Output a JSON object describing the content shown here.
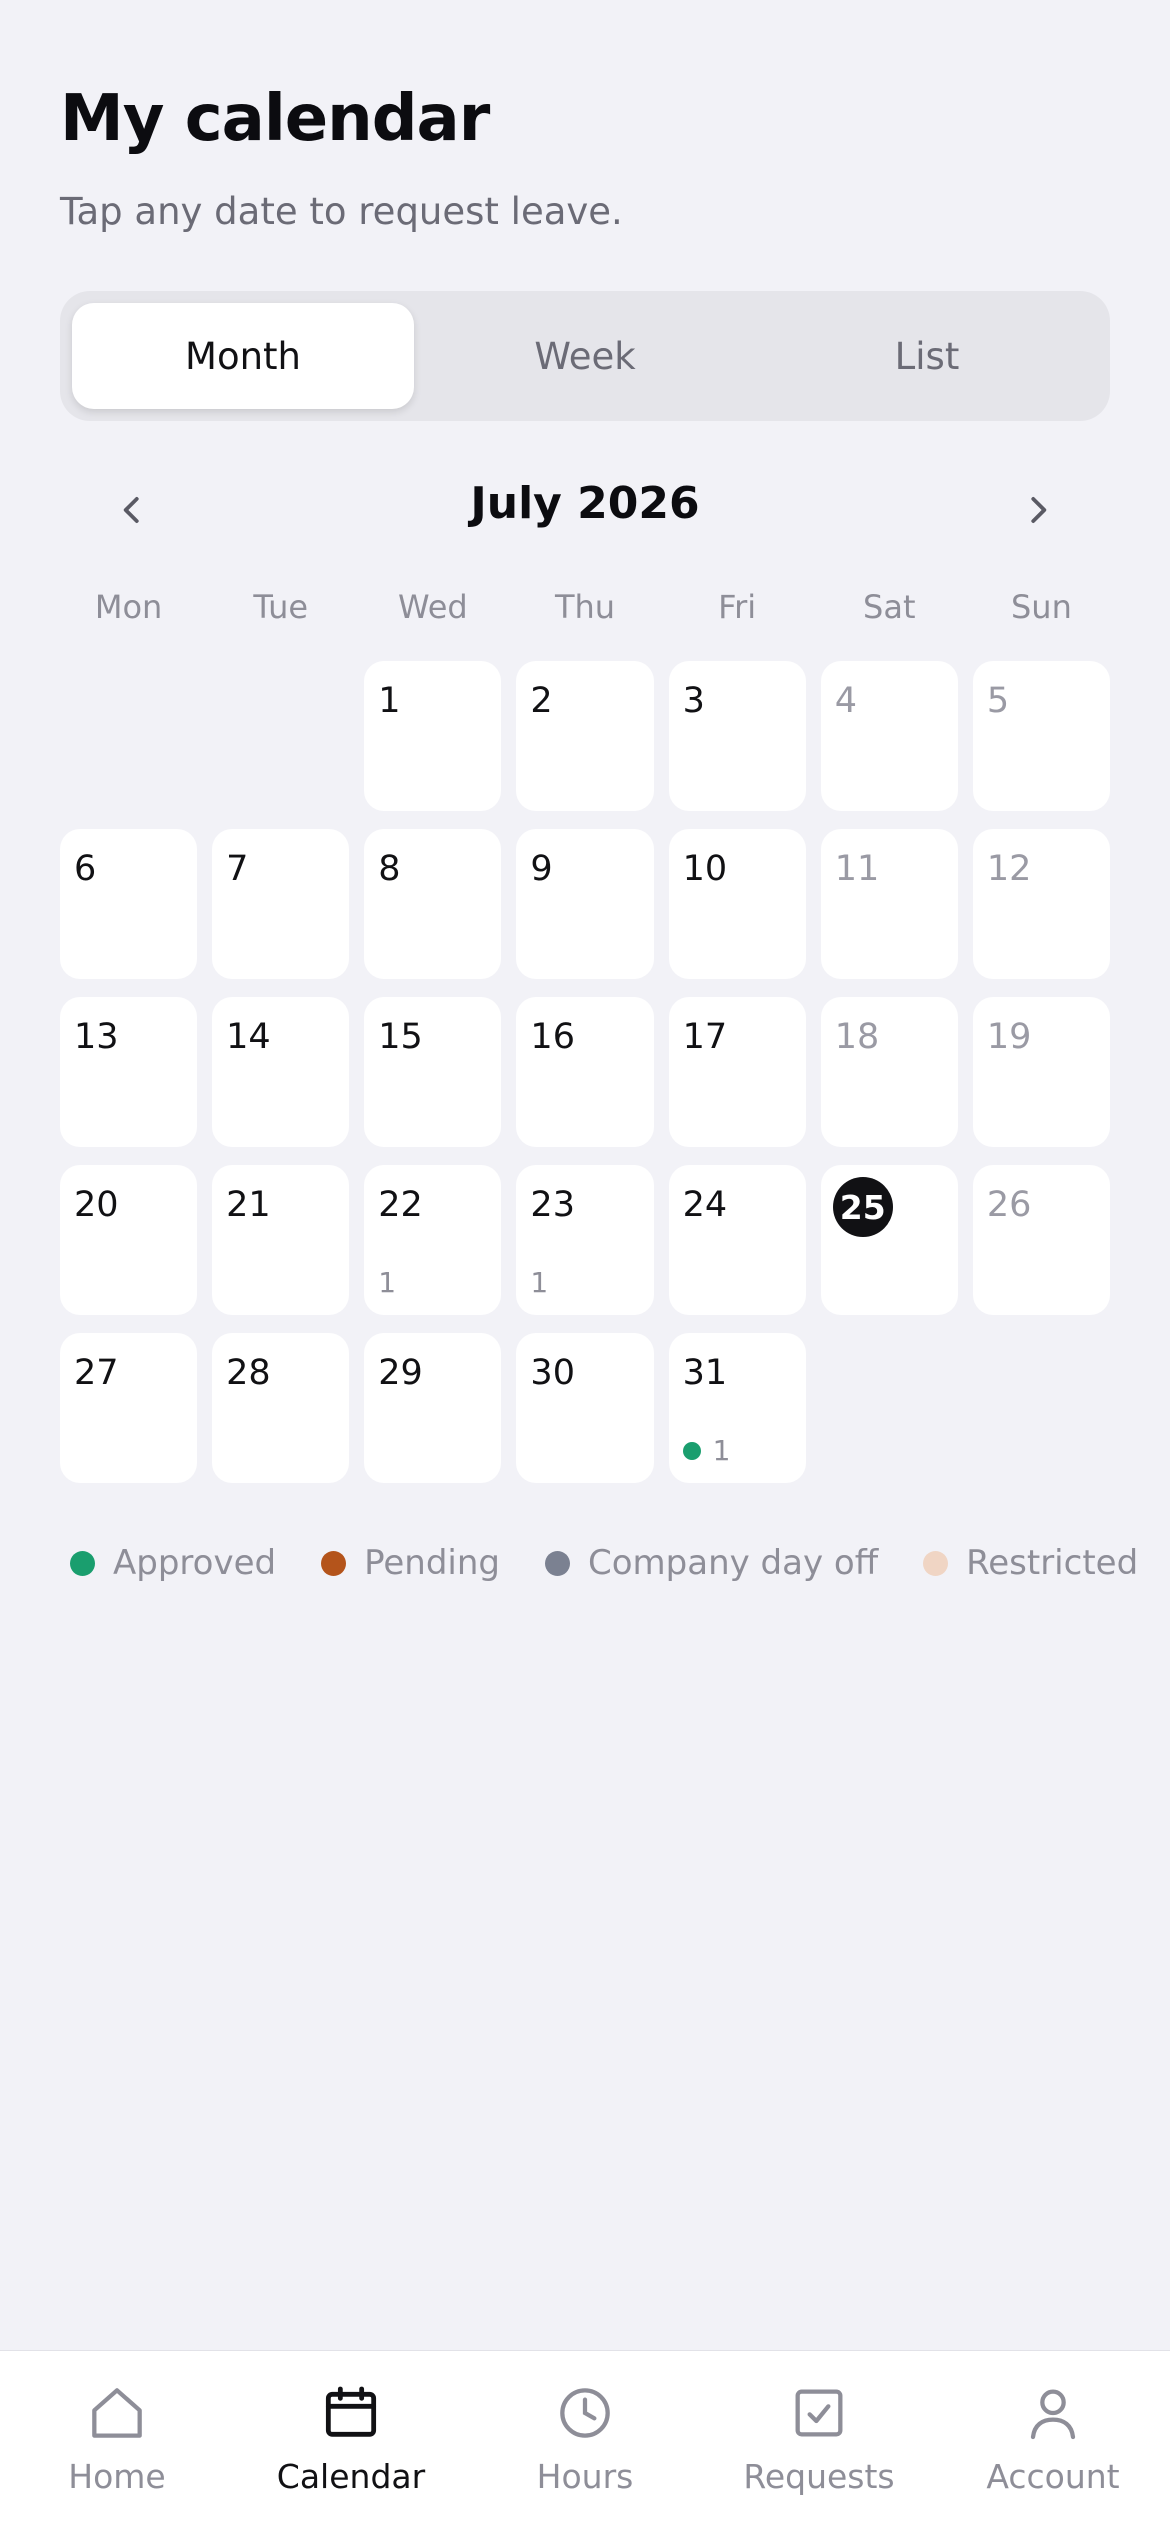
{
  "header": {
    "title": "My calendar",
    "subtitle": "Tap any date to request leave."
  },
  "view_switch": {
    "options": [
      "Month",
      "Week",
      "List"
    ],
    "selected": "Month"
  },
  "month_nav": {
    "label": "July 2026",
    "prev_icon": "chevron-left-icon",
    "next_icon": "chevron-right-icon"
  },
  "weekdays": [
    "Mon",
    "Tue",
    "Wed",
    "Thu",
    "Fri",
    "Sat",
    "Sun"
  ],
  "calendar": {
    "leading_blank_days": 2,
    "today": 25,
    "days": [
      {
        "day": "1",
        "weekend": false
      },
      {
        "day": "2",
        "weekend": false
      },
      {
        "day": "3",
        "weekend": false
      },
      {
        "day": "4",
        "weekend": true
      },
      {
        "day": "5",
        "weekend": true
      },
      {
        "day": "6",
        "weekend": false
      },
      {
        "day": "7",
        "weekend": false
      },
      {
        "day": "8",
        "weekend": false
      },
      {
        "day": "9",
        "weekend": false
      },
      {
        "day": "10",
        "weekend": false
      },
      {
        "day": "11",
        "weekend": true
      },
      {
        "day": "12",
        "weekend": true
      },
      {
        "day": "13",
        "weekend": false
      },
      {
        "day": "14",
        "weekend": false
      },
      {
        "day": "15",
        "weekend": false
      },
      {
        "day": "16",
        "weekend": false
      },
      {
        "day": "17",
        "weekend": false
      },
      {
        "day": "18",
        "weekend": true
      },
      {
        "day": "19",
        "weekend": true
      },
      {
        "day": "20",
        "weekend": false
      },
      {
        "day": "21",
        "weekend": false
      },
      {
        "day": "22",
        "weekend": false,
        "count": "1"
      },
      {
        "day": "23",
        "weekend": false,
        "count": "1"
      },
      {
        "day": "24",
        "weekend": false
      },
      {
        "day": "25",
        "weekend": true,
        "today": true
      },
      {
        "day": "26",
        "weekend": true
      },
      {
        "day": "27",
        "weekend": false
      },
      {
        "day": "28",
        "weekend": false
      },
      {
        "day": "29",
        "weekend": false
      },
      {
        "day": "30",
        "weekend": false
      },
      {
        "day": "31",
        "weekend": false,
        "count": "1",
        "status": "approved"
      }
    ]
  },
  "legend": [
    {
      "label": "Approved",
      "key": "approved",
      "color": "#1a9e6e"
    },
    {
      "label": "Pending",
      "key": "pending",
      "color": "#b4541b"
    },
    {
      "label": "Company day off",
      "key": "company",
      "color": "#7b8191"
    },
    {
      "label": "Restricted",
      "key": "restricted",
      "color": "#f0d5c4"
    }
  ],
  "tabbar": {
    "items": [
      {
        "label": "Home",
        "icon": "home-icon",
        "active": false
      },
      {
        "label": "Calendar",
        "icon": "calendar-icon",
        "active": true
      },
      {
        "label": "Hours",
        "icon": "clock-icon",
        "active": false
      },
      {
        "label": "Requests",
        "icon": "checkbox-icon",
        "active": false
      },
      {
        "label": "Account",
        "icon": "person-icon",
        "active": false
      }
    ]
  },
  "colors": {
    "background": "#f2f2f7",
    "today": "#111114",
    "inactive": "#8e8e98"
  }
}
